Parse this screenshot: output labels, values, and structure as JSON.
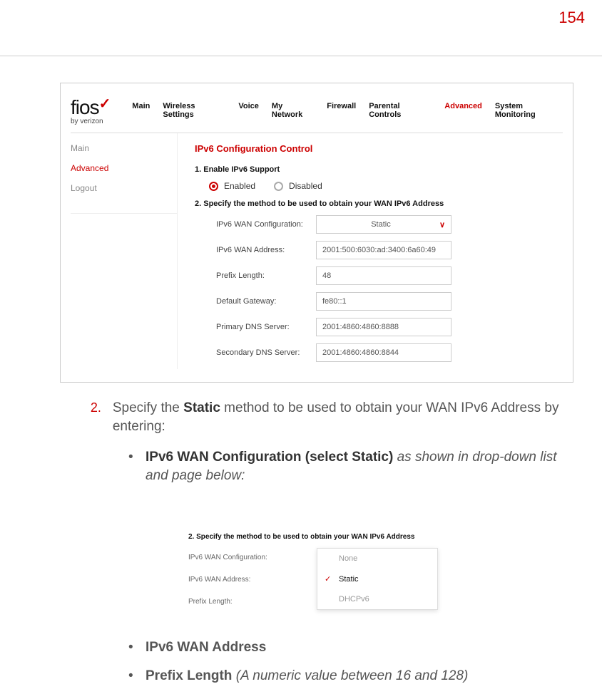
{
  "page_number": "154",
  "shot1": {
    "logo_text": "fios",
    "logo_sub": "by verizon",
    "nav": [
      "Main",
      "Wireless Settings",
      "Voice",
      "My Network",
      "Firewall",
      "Parental Controls",
      "Advanced",
      "System Monitoring"
    ],
    "nav_active": "Advanced",
    "side": {
      "main": "Main",
      "advanced": "Advanced",
      "logout": "Logout"
    },
    "section_title": "IPv6 Configuration Control",
    "step1": "1. Enable IPv6 Support",
    "enabled": "Enabled",
    "disabled": "Disabled",
    "step2": "2. Specify the method to be used to obtain your WAN IPv6 Address",
    "fields": {
      "wan_conf_lab": "IPv6 WAN Configuration:",
      "wan_conf_val": "Static",
      "wan_addr_lab": "IPv6 WAN Address:",
      "wan_addr_val": "2001:500:6030:ad:3400:6a60:49",
      "prefix_lab": "Prefix Length:",
      "prefix_val": "48",
      "gw_lab": "Default Gateway:",
      "gw_val": "fe80::1",
      "dns1_lab": "Primary DNS Server:",
      "dns1_val": "2001:4860:4860:8888",
      "dns2_lab": "Secondary DNS Server:",
      "dns2_val": "2001:4860:4860:8844"
    }
  },
  "instr": {
    "num": "2.",
    "line1a": "Specify the ",
    "line1b": "Static",
    "line1c": " method to be used to obtain your WAN IPv6 Address by entering:",
    "bullet": "•",
    "b1a": "IPv6 WAN Configuration (select Static) ",
    "b1b": "as shown in drop-down list and page below:",
    "b2": "IPv6 WAN Address",
    "b3a": "Prefix Length ",
    "b3b": "(A numeric value between 16 and 128)"
  },
  "shot2": {
    "step": "2. Specify the method to be used to obtain your WAN IPv6 Address",
    "left": {
      "wan_conf": "IPv6 WAN Configuration:",
      "wan_addr": "IPv6 WAN Address:",
      "prefix": "Prefix Length:"
    },
    "dd": {
      "none": "None",
      "static": "Static",
      "dhcp": "DHCPv6"
    }
  }
}
